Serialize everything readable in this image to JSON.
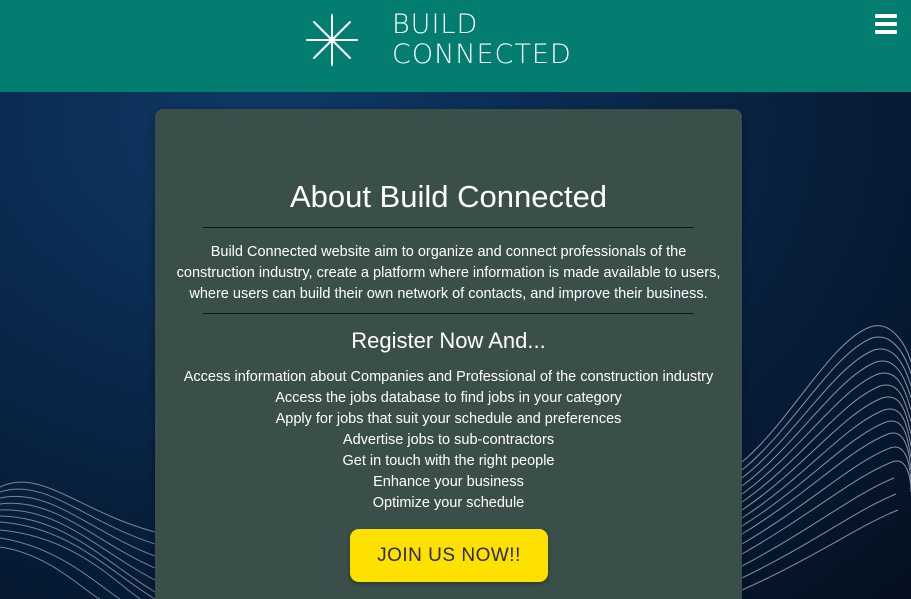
{
  "header": {
    "logo_icon": "asterisk-star-icon",
    "logo_line1": "BUILD",
    "logo_line2": "CONNECTED",
    "menu_icon": "hamburger-menu-icon",
    "background_color": "#027d70"
  },
  "card": {
    "title": "About Build Connected",
    "about_text": "Build Connected website aim to organize and connect professionals of the construction industry, create a platform where information is made available to users, where users can build their own network of contacts, and improve their business.",
    "register_heading": "Register Now And...",
    "benefits": [
      "Access information about Companies and Professional of the construction industry",
      "Access the jobs database to find jobs in your category",
      "Apply for jobs that suit your schedule and preferences",
      "Advertise jobs to sub-contractors",
      "Get in touch with the right people",
      "Enhance your business",
      "Optimize your schedule"
    ],
    "join_button_label": "JOIN US NOW!!",
    "background_color": "#3b4f4a",
    "button_color": "#ffe100"
  }
}
